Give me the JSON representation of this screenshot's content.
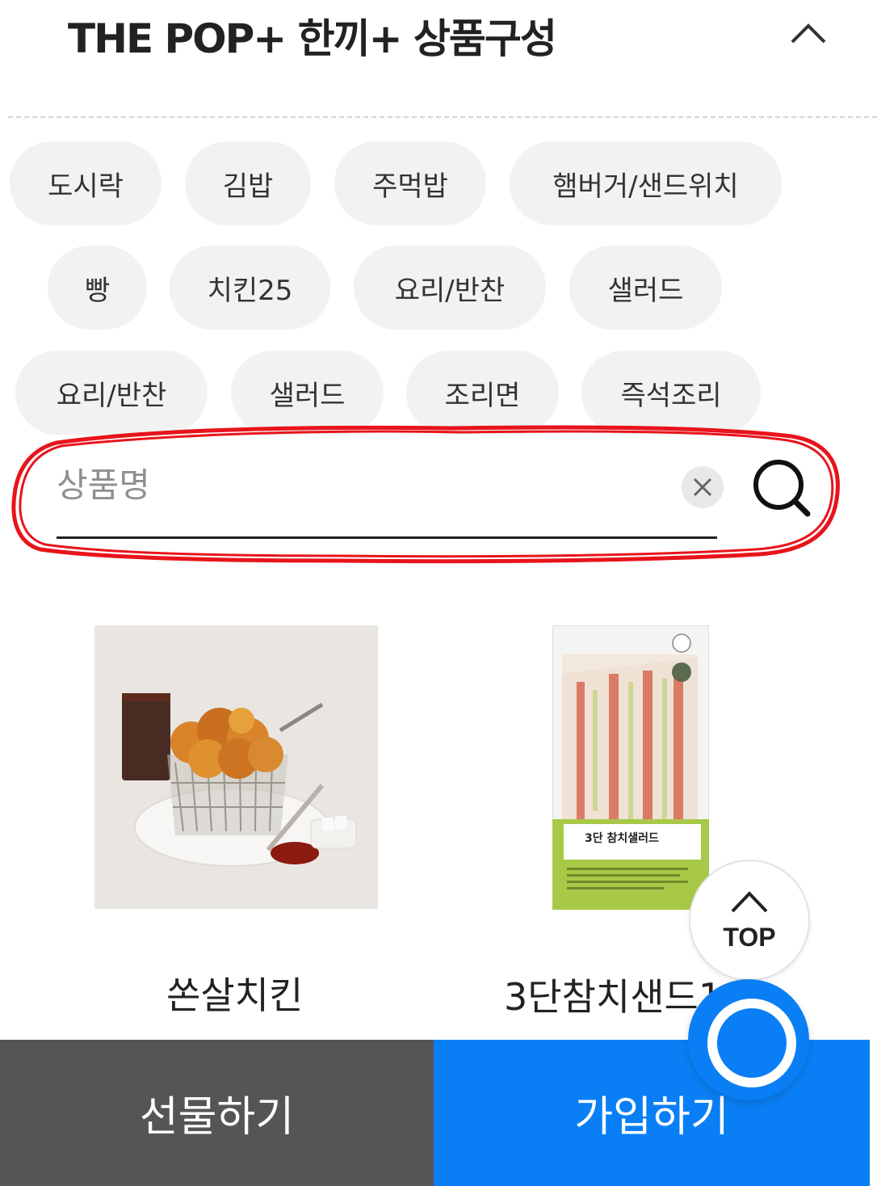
{
  "header": {
    "title": "THE POP+ 한끼+ 상품구성",
    "collapse_icon": "chevron-up-icon"
  },
  "categories": [
    "도시락",
    "김밥",
    "주먹밥",
    "햄버거/샌드위치",
    "빵",
    "치킨25",
    "요리/반찬",
    "샐러드",
    "요리/반찬",
    "샐러드",
    "조리면",
    "즉석조리"
  ],
  "search": {
    "placeholder": "상품명",
    "value": "",
    "clear_icon": "close-icon",
    "search_icon": "search-icon",
    "annotation_color": "#e8141b"
  },
  "products": [
    {
      "name": "쏜살치킨",
      "image": "fried-chicken-basket-photo"
    },
    {
      "name": "3단참치샌드1",
      "image": "tuna-sandwich-package-photo",
      "package_text": "3단 참치샐러드"
    }
  ],
  "top_button": {
    "label": "TOP",
    "icon": "chevron-up-icon"
  },
  "bottom_bar": {
    "gift_label": "선물하기",
    "join_label": "가입하기",
    "gift_color": "#555555",
    "join_color": "#0a7ff5"
  },
  "chat_button": {
    "icon": "chat-bubble-icon"
  }
}
